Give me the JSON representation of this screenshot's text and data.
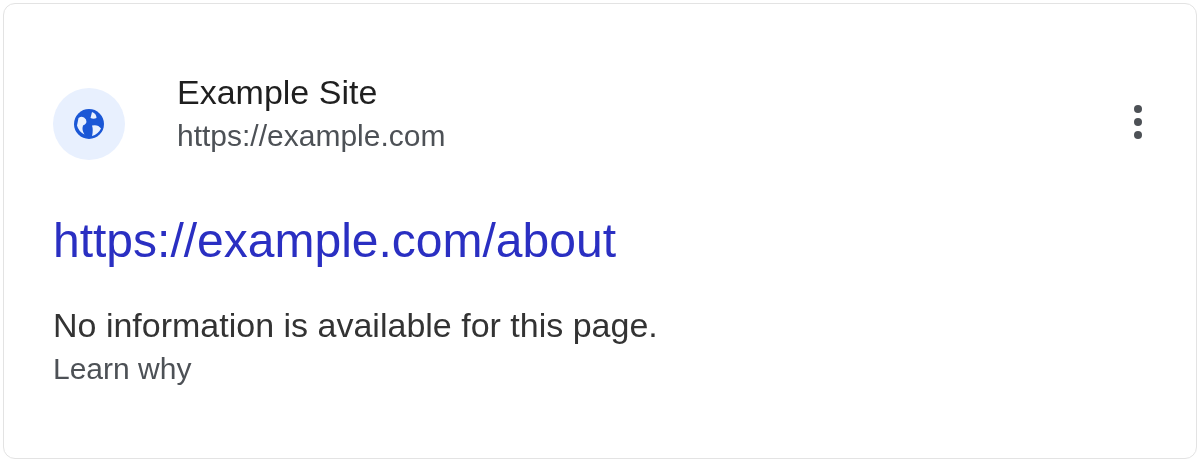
{
  "result": {
    "site_name": "Example Site",
    "site_url": "https://example.com",
    "title_link": "https://example.com/about",
    "snippet": "No information is available for this page.",
    "learn_link": "Learn why"
  }
}
